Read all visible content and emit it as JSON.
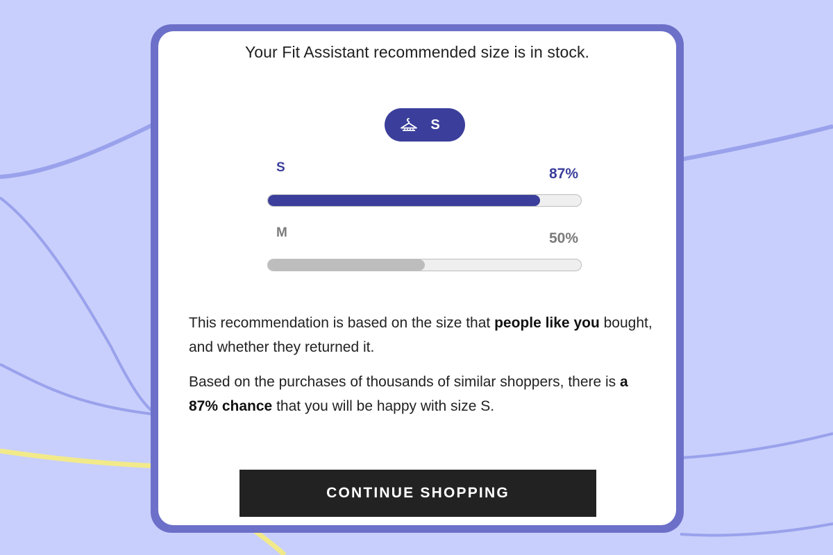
{
  "colors": {
    "background": "#c8cffc",
    "frame": "#6d70c8",
    "accent": "#3b3f9b",
    "secondary_bar": "#bdbdbd",
    "button": "#222222",
    "highlight_line": "#f2ea8a"
  },
  "dialog": {
    "headline": "Your Fit Assistant recommended size is in stock.",
    "recommended_badge": {
      "icon": "hanger-icon",
      "size": "S"
    },
    "sizes": [
      {
        "label": "S",
        "percent_text": "87%",
        "value": 0.87
      },
      {
        "label": "M",
        "percent_text": "50%",
        "value": 0.5
      }
    ],
    "explanation_1": {
      "text_before": "This recommendation is based on the size that ",
      "emphasis": "people like you",
      "text_after": " bought, and whether they returned it."
    },
    "explanation_2": {
      "text_before": "Based on the purchases of thousands of similar shoppers, there is ",
      "emphasis": "a 87% chance",
      "text_after": " that you will be happy with size S."
    },
    "continue_button": "CONTINUE SHOPPING"
  }
}
